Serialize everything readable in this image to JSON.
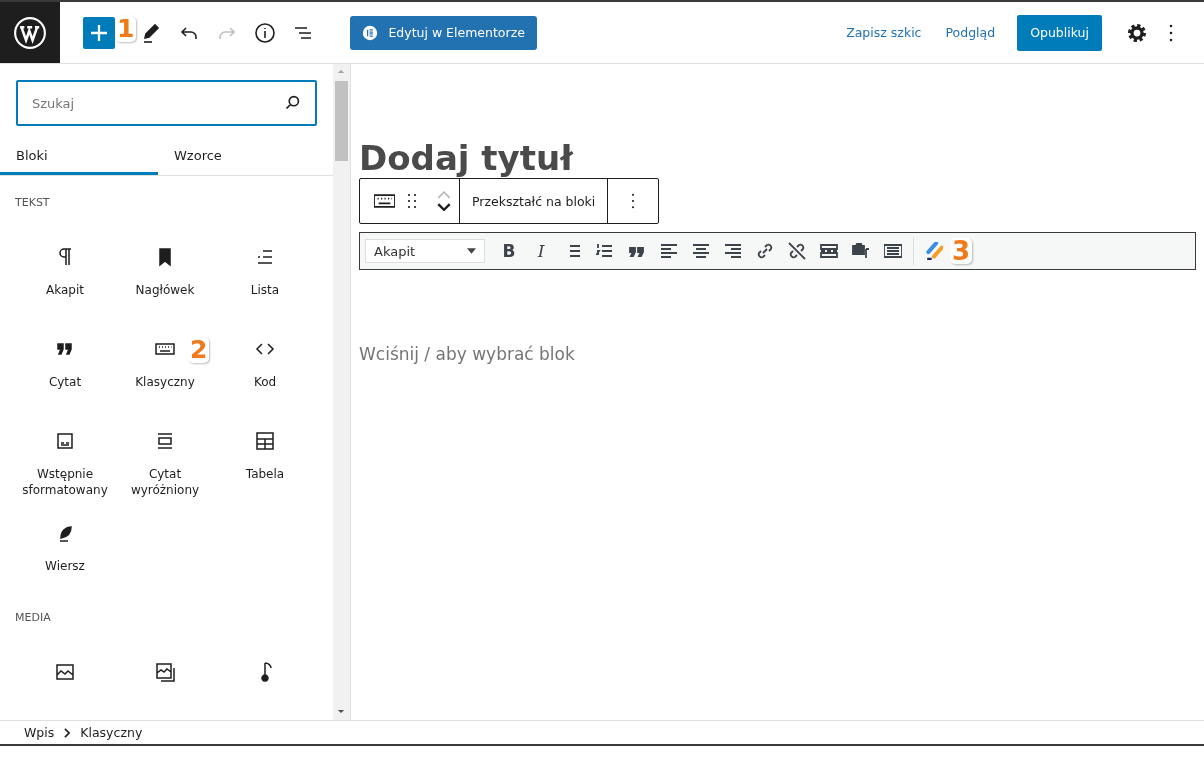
{
  "top_bar": {
    "inserter_callout": "1",
    "elementor_button": "Edytuj w Elementorze",
    "save_draft": "Zapisz szkic",
    "preview": "Podgląd",
    "publish": "Opublikuj"
  },
  "inserter": {
    "search": {
      "placeholder": "Szukaj"
    },
    "tabs": [
      {
        "label": "Bloki",
        "selected": true
      },
      {
        "label": "Wzorce",
        "selected": false
      }
    ],
    "sections": [
      {
        "title": "TEKST",
        "blocks": [
          {
            "kind": "paragraph",
            "label": "Akapit"
          },
          {
            "kind": "heading",
            "label": "Nagłówek"
          },
          {
            "kind": "list",
            "label": "Lista"
          },
          {
            "kind": "quote",
            "label": "Cytat"
          },
          {
            "kind": "classic",
            "label": "Klasyczny",
            "callout": "2"
          },
          {
            "kind": "code",
            "label": "Kod"
          },
          {
            "kind": "preformatted",
            "label": "Wstępnie sformatowany"
          },
          {
            "kind": "pullquote",
            "label": "Cytat wyróżniony"
          },
          {
            "kind": "table",
            "label": "Tabela"
          },
          {
            "kind": "verse",
            "label": "Wiersz"
          }
        ]
      },
      {
        "title": "MEDIA",
        "blocks": [
          {
            "kind": "image"
          },
          {
            "kind": "gallery"
          },
          {
            "kind": "audio"
          }
        ]
      }
    ]
  },
  "editor": {
    "title_placeholder": "Dodaj tytuł",
    "block_toolbar": {
      "action": "Przekształć na bloki"
    },
    "classic_toolbar": {
      "format": "Akapit",
      "callout": "3",
      "tools": [
        {
          "kind": "bold",
          "label": "B"
        },
        {
          "kind": "italic",
          "label": "I"
        },
        {
          "kind": "bullets"
        },
        {
          "kind": "numbers"
        },
        {
          "kind": "blockquote"
        },
        {
          "kind": "align-left"
        },
        {
          "kind": "align-center"
        },
        {
          "kind": "align-right"
        },
        {
          "kind": "link"
        },
        {
          "kind": "unlink"
        },
        {
          "kind": "read-more"
        },
        {
          "kind": "add-media"
        },
        {
          "kind": "toolbar-toggle"
        }
      ]
    },
    "prompt": "Wciśnij / aby wybrać blok"
  },
  "breadcrumb": [
    "Wpis",
    "Klasyczny"
  ]
}
